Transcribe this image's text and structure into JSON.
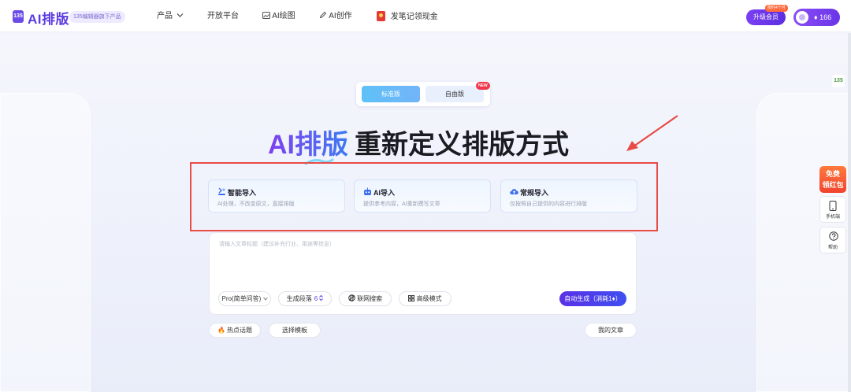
{
  "header": {
    "logo_badge": "135",
    "logo": "AI排版",
    "logo_sub": "135编辑器旗下产品",
    "nav": [
      {
        "label": "产品",
        "icon": "chevron-down-icon"
      },
      {
        "label": "开放平台"
      },
      {
        "label": "AI绘图",
        "icon": "image-icon"
      },
      {
        "label": "AI创作",
        "icon": "pen-icon"
      },
      {
        "label": "发笔记领现金",
        "icon": "red-envelope-icon"
      }
    ],
    "upgrade_label": "升级会员",
    "upgrade_tag": "限时4个月",
    "credits": "166"
  },
  "version_tabs": {
    "standard": "标准版",
    "free": "自由版",
    "new_tag": "NEW"
  },
  "headline": {
    "highlight": "AI排版",
    "rest": "重新定义排版方式"
  },
  "cards": [
    {
      "title": "智能导入",
      "desc": "AI处理，不改变原文，直接排版",
      "icon": "smart-import-icon"
    },
    {
      "title": "AI导入",
      "desc": "提供参考内容，AI重新撰写文章",
      "icon": "robot-icon"
    },
    {
      "title": "常规导入",
      "desc": "仅按照自己提供的内容进行排版",
      "icon": "cloud-upload-icon"
    }
  ],
  "input": {
    "placeholder": "请输入文章标题（建议补充行业、用途等信息）"
  },
  "toolbar": {
    "mode": "Pro(简单问答)",
    "paragraphs_label": "生成段落",
    "paragraphs_value": "6",
    "web_search": "联网搜索",
    "advanced": "高级模式",
    "generate": "自动生成（消耗1"
  },
  "bottom": {
    "hot_topics": "热点话题",
    "choose_template": "选择模板",
    "my_articles": "我的文章"
  },
  "side": {
    "logo": "135",
    "redpack_line1": "免费",
    "redpack_line2": "领红包",
    "mobile": "手机端",
    "help": "帮助"
  },
  "colors": {
    "brand": "#5b3be0",
    "annotation": "#e84b45",
    "standard_tab": "#5ec1f7"
  }
}
